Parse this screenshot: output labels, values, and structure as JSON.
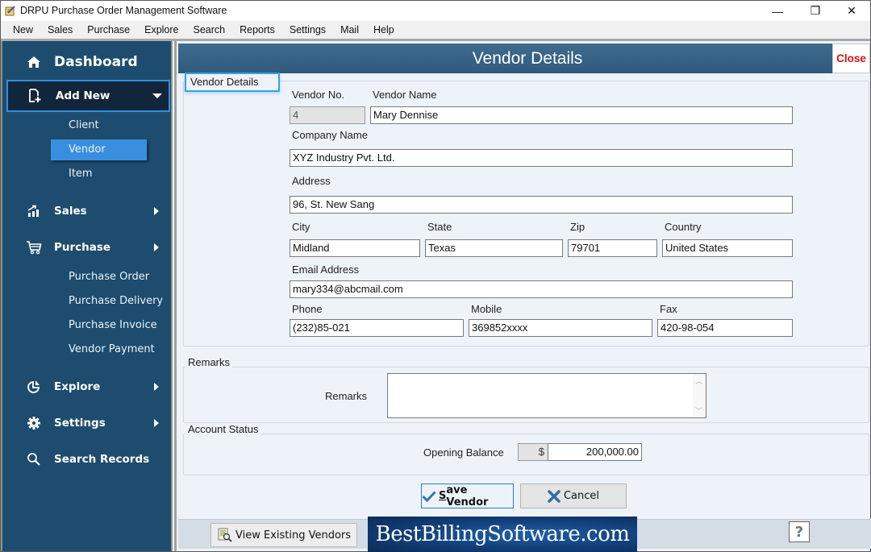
{
  "window": {
    "title": "DRPU Purchase Order Management Software",
    "controls": {
      "minimize": "—",
      "maximize": "❐",
      "close": "✕"
    }
  },
  "menu": [
    "New",
    "Sales",
    "Purchase",
    "Explore",
    "Search",
    "Reports",
    "Settings",
    "Mail",
    "Help"
  ],
  "sidebar": {
    "dashboard": {
      "label": "Dashboard",
      "icon": "home-icon"
    },
    "add_new": {
      "label": "Add New",
      "icon": "add-document-icon",
      "expanded": true,
      "children": [
        "Client",
        "Vendor",
        "Item"
      ],
      "active_child": "Vendor"
    },
    "sales": {
      "label": "Sales",
      "icon": "chart-growth-icon"
    },
    "purchase": {
      "label": "Purchase",
      "icon": "cart-icon",
      "children": [
        "Purchase Order",
        "Purchase Delivery",
        "Purchase Invoice",
        "Vendor Payment"
      ]
    },
    "explore": {
      "label": "Explore",
      "icon": "pie-chart-icon"
    },
    "settings": {
      "label": "Settings",
      "icon": "gear-icon"
    },
    "search": {
      "label": "Search Records",
      "icon": "search-icon"
    }
  },
  "header": {
    "title": "Vendor Details",
    "close_label": "Close"
  },
  "vendor_details": {
    "legend": "Vendor Details",
    "vendor_no": {
      "label": "Vendor No.",
      "value": "4"
    },
    "vendor_name": {
      "label": "Vendor Name",
      "value": "Mary Dennise"
    },
    "company_name": {
      "label": "Company Name",
      "value": "XYZ Industry Pvt. Ltd."
    },
    "address": {
      "label": "Address",
      "value": "96, St. New Sang"
    },
    "city": {
      "label": "City",
      "value": "Midland"
    },
    "state": {
      "label": "State",
      "value": "Texas"
    },
    "zip": {
      "label": "Zip",
      "value": "79701"
    },
    "country": {
      "label": "Country",
      "value": "United States"
    },
    "email": {
      "label": "Email Address",
      "value": "mary334@abcmail.com"
    },
    "phone": {
      "label": "Phone",
      "value": "(232)85-021"
    },
    "mobile": {
      "label": "Mobile",
      "value": "369852xxxx"
    },
    "fax": {
      "label": "Fax",
      "value": "420-98-054"
    }
  },
  "remarks": {
    "legend": "Remarks",
    "label": "Remarks",
    "value": ""
  },
  "account_status": {
    "legend": "Account Status",
    "opening_balance_label": "Opening Balance",
    "currency_symbol": "$",
    "opening_balance": "200,000.00"
  },
  "actions": {
    "save_label_first": "S",
    "save_label_rest": "ave Vendor",
    "cancel_label": "Cancel"
  },
  "footer": {
    "view_existing_label": "View Existing Vendors",
    "banner_text": "BestBillingSoftware.com",
    "help_label": "?"
  },
  "colors": {
    "sidebar_bg": "#1e4c6e",
    "active_item": "#3a8ee0",
    "header_bg": "#2f5a7c",
    "close_text": "#e01010",
    "panel_bg": "#eef3fa"
  }
}
